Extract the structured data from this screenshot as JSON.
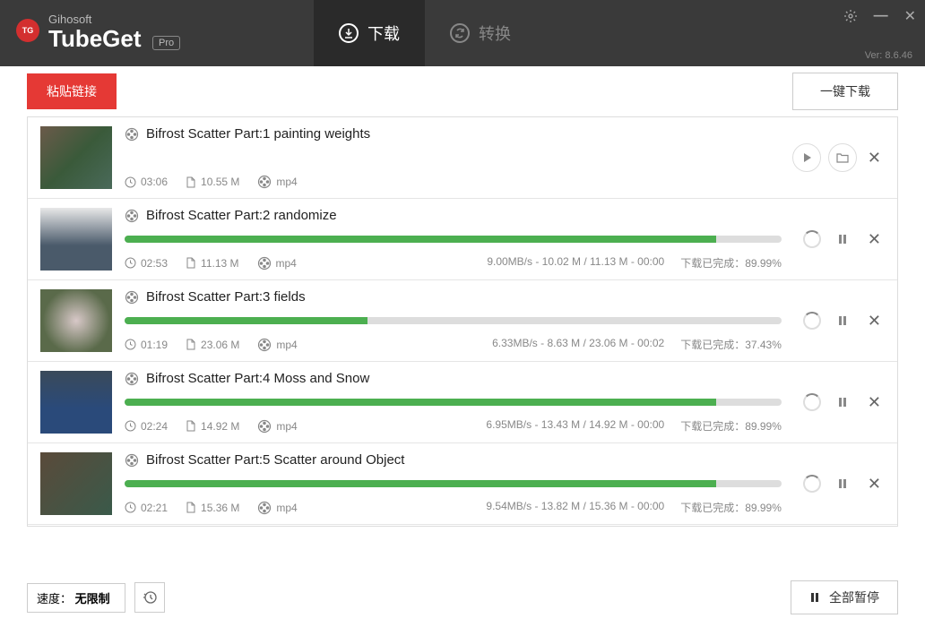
{
  "header": {
    "brand_small": "Gihosoft",
    "brand_big": "TubeGet",
    "pro": "Pro",
    "tabs": {
      "download": "下载",
      "convert": "转换"
    },
    "version": "Ver: 8.6.46"
  },
  "toolbar": {
    "paste": "粘贴链接",
    "onekey": "一键下载"
  },
  "downloads": [
    {
      "title": "Bifrost Scatter Part:1 painting weights",
      "duration": "03:06",
      "size": "10.55 M",
      "format": "mp4",
      "progress": null,
      "speed_text": "",
      "status": "",
      "completed": true
    },
    {
      "title": "Bifrost Scatter Part:2 randomize",
      "duration": "02:53",
      "size": "11.13 M",
      "format": "mp4",
      "progress": 90,
      "speed_text": "9.00MB/s - 10.02 M / 11.13 M - 00:00",
      "status": "下载已完成：89.99%",
      "completed": false
    },
    {
      "title": "Bifrost Scatter Part:3 fields",
      "duration": "01:19",
      "size": "23.06 M",
      "format": "mp4",
      "progress": 37,
      "speed_text": "6.33MB/s - 8.63 M / 23.06 M - 00:02",
      "status": "下载已完成：37.43%",
      "completed": false
    },
    {
      "title": "Bifrost Scatter Part:4 Moss and Snow",
      "duration": "02:24",
      "size": "14.92 M",
      "format": "mp4",
      "progress": 90,
      "speed_text": "6.95MB/s - 13.43 M / 14.92 M - 00:00",
      "status": "下载已完成：89.99%",
      "completed": false
    },
    {
      "title": "Bifrost Scatter Part:5 Scatter around Object",
      "duration": "02:21",
      "size": "15.36 M",
      "format": "mp4",
      "progress": 90,
      "speed_text": "9.54MB/s - 13.82 M / 15.36 M - 00:00",
      "status": "下载已完成：89.99%",
      "completed": false
    }
  ],
  "footer": {
    "speed_label": "速度：",
    "speed_value": "无限制",
    "pause_all": "全部暂停"
  }
}
